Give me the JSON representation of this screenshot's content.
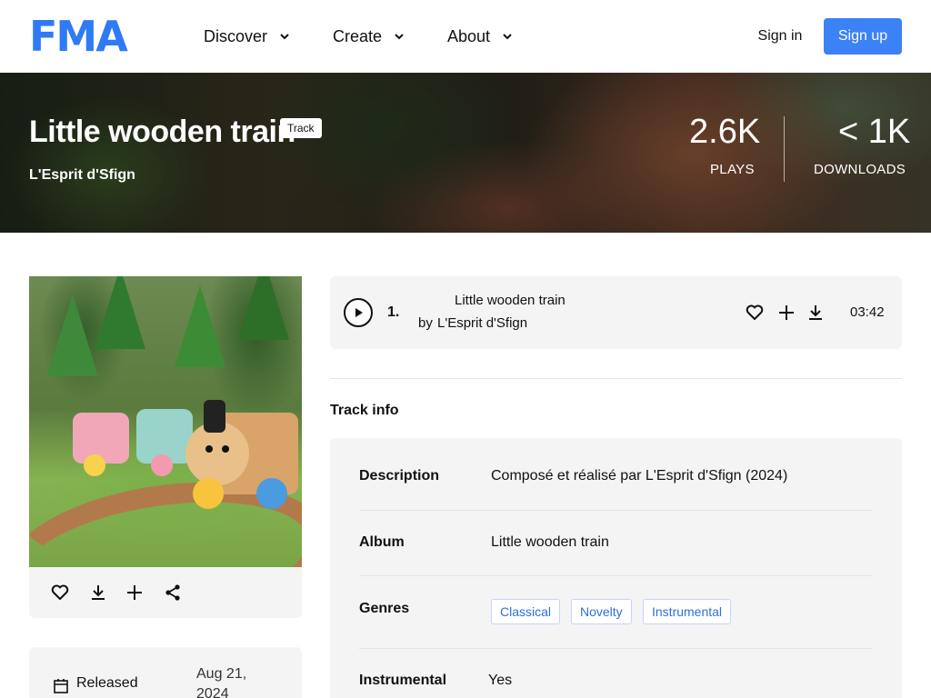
{
  "header": {
    "logo": "FMA",
    "nav": [
      {
        "label": "Discover"
      },
      {
        "label": "Create"
      },
      {
        "label": "About"
      }
    ],
    "signin_label": "Sign in",
    "signup_label": "Sign up"
  },
  "hero": {
    "title": "Little wooden train",
    "badge": "Track",
    "artist": "L'Esprit d'Sfign",
    "plays_value": "2.6K",
    "plays_label": "PLAYS",
    "downloads_value": "< 1K",
    "downloads_label": "DOWNLOADS"
  },
  "player": {
    "track_number": "1.",
    "title": "Little wooden train",
    "by": "by",
    "artist": "L'Esprit d'Sfign",
    "duration": "03:42"
  },
  "track_info": {
    "heading": "Track info",
    "rows": [
      {
        "label": "Description",
        "value": "Composé et réalisé par L'Esprit d'Sfign (2024)"
      },
      {
        "label": "Album",
        "value": "Little wooden train"
      },
      {
        "label": "Genres",
        "tags": [
          "Classical",
          "Novelty",
          "Instrumental"
        ]
      },
      {
        "label": "Instrumental",
        "value": "Yes"
      }
    ]
  },
  "release": {
    "label": "Released",
    "date_line1": "Aug 21,",
    "date_line2": "2024"
  },
  "colors": {
    "brand": "#2f7bf5",
    "signup": "#3b82f6",
    "tag_text": "#2f6fdd"
  }
}
